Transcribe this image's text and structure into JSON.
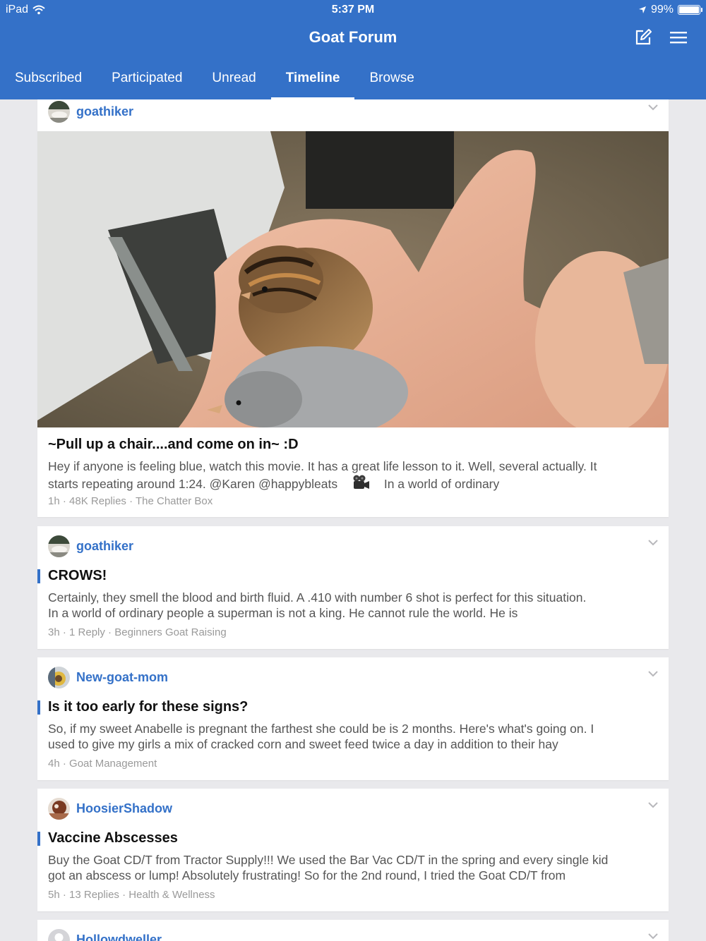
{
  "status": {
    "carrier": "iPad",
    "time": "5:37 PM",
    "battery": "99%",
    "battery_fraction": 0.99
  },
  "header": {
    "title": "Goat Forum"
  },
  "tabs": [
    {
      "label": "Subscribed",
      "active": false
    },
    {
      "label": "Participated",
      "active": false
    },
    {
      "label": "Unread",
      "active": false
    },
    {
      "label": "Timeline",
      "active": true
    },
    {
      "label": "Browse",
      "active": false
    }
  ],
  "posts": [
    {
      "author": "goathiker",
      "title": "~Pull up a chair....and come on in~ :D",
      "excerpt_line1": "Hey if anyone is feeling blue, watch this movie. It has a great life lesson to it. Well, several actually. It",
      "excerpt_line2a": "starts repeating around 1:24. @Karen  @happybleats",
      "excerpt_line2b": "In a world of ordinary",
      "excerpt_icon": "movie-camera-icon",
      "time": "1h",
      "replies": "48K Replies",
      "forum": "The Chatter Box",
      "has_image": true
    },
    {
      "author": "goathiker",
      "title": "CROWS!",
      "excerpt_line1": "Certainly, they smell the blood and birth fluid.  A .410 with number 6 shot is perfect for this situation.",
      "excerpt_line2": "In a world of ordinary people a superman is not a king.  He cannot rule the world.  He is",
      "time": "3h",
      "replies": "1 Reply",
      "forum": "Beginners Goat Raising",
      "unread": true
    },
    {
      "author": "New-goat-mom",
      "title": "Is it too early for these signs?",
      "excerpt_line1": "So, if my sweet Anabelle is pregnant the farthest she could be is 2 months. Here's what's going on. I",
      "excerpt_line2": "used to give my girls a mix of cracked corn and sweet feed twice a day in addition to their hay",
      "time": "4h",
      "forum": "Goat Management",
      "unread": true
    },
    {
      "author": "HoosierShadow",
      "title": "Vaccine Abscesses",
      "excerpt_line1": "Buy the Goat CD/T from Tractor Supply!!!  We used the Bar Vac CD/T in the spring and every single kid",
      "excerpt_line2": "got an abscess or lump!  Absolutely frustrating! So for the 2nd round, I tried the Goat CD/T from",
      "time": "5h",
      "replies": "13 Replies",
      "forum": "Health & Wellness",
      "unread": true
    },
    {
      "author": "Hollowdweller"
    }
  ],
  "colors": {
    "accent": "#3471c8",
    "background": "#e9e9ec",
    "card": "#ffffff",
    "meta": "#9a9a9a"
  }
}
